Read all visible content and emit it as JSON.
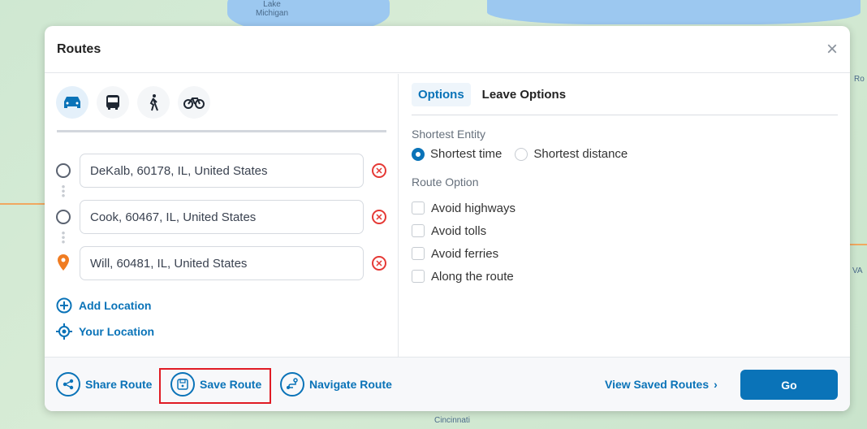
{
  "map": {
    "labels": [
      "Lake\nMichigan",
      "Ro",
      "VA",
      "Cincinnati"
    ]
  },
  "modal": {
    "title": "Routes",
    "close": "×"
  },
  "modes": [
    {
      "name": "car",
      "active": true
    },
    {
      "name": "bus"
    },
    {
      "name": "walk"
    },
    {
      "name": "bike"
    }
  ],
  "stops": [
    {
      "value": "DeKalb, 60178, IL, United States"
    },
    {
      "value": "Cook, 60467, IL, United States"
    },
    {
      "value": "Will, 60481, IL, United States"
    }
  ],
  "links": {
    "add": "Add Location",
    "yours": "Your Location"
  },
  "tabs": [
    "Options",
    "Leave Options"
  ],
  "options": {
    "entity_label": "Shortest Entity",
    "entity": [
      "Shortest time",
      "Shortest distance"
    ],
    "selected": "Shortest time",
    "route_label": "Route Option",
    "route": [
      "Avoid highways",
      "Avoid tolls",
      "Avoid ferries",
      "Along the route"
    ]
  },
  "footer": {
    "share": "Share Route",
    "save": "Save Route",
    "navigate": "Navigate Route",
    "view": "View Saved Routes",
    "go": "Go"
  },
  "colors": {
    "accent": "#0a73b8",
    "remove": "#e53935",
    "highlight": "#e01b24",
    "destination": "#f07c22"
  }
}
